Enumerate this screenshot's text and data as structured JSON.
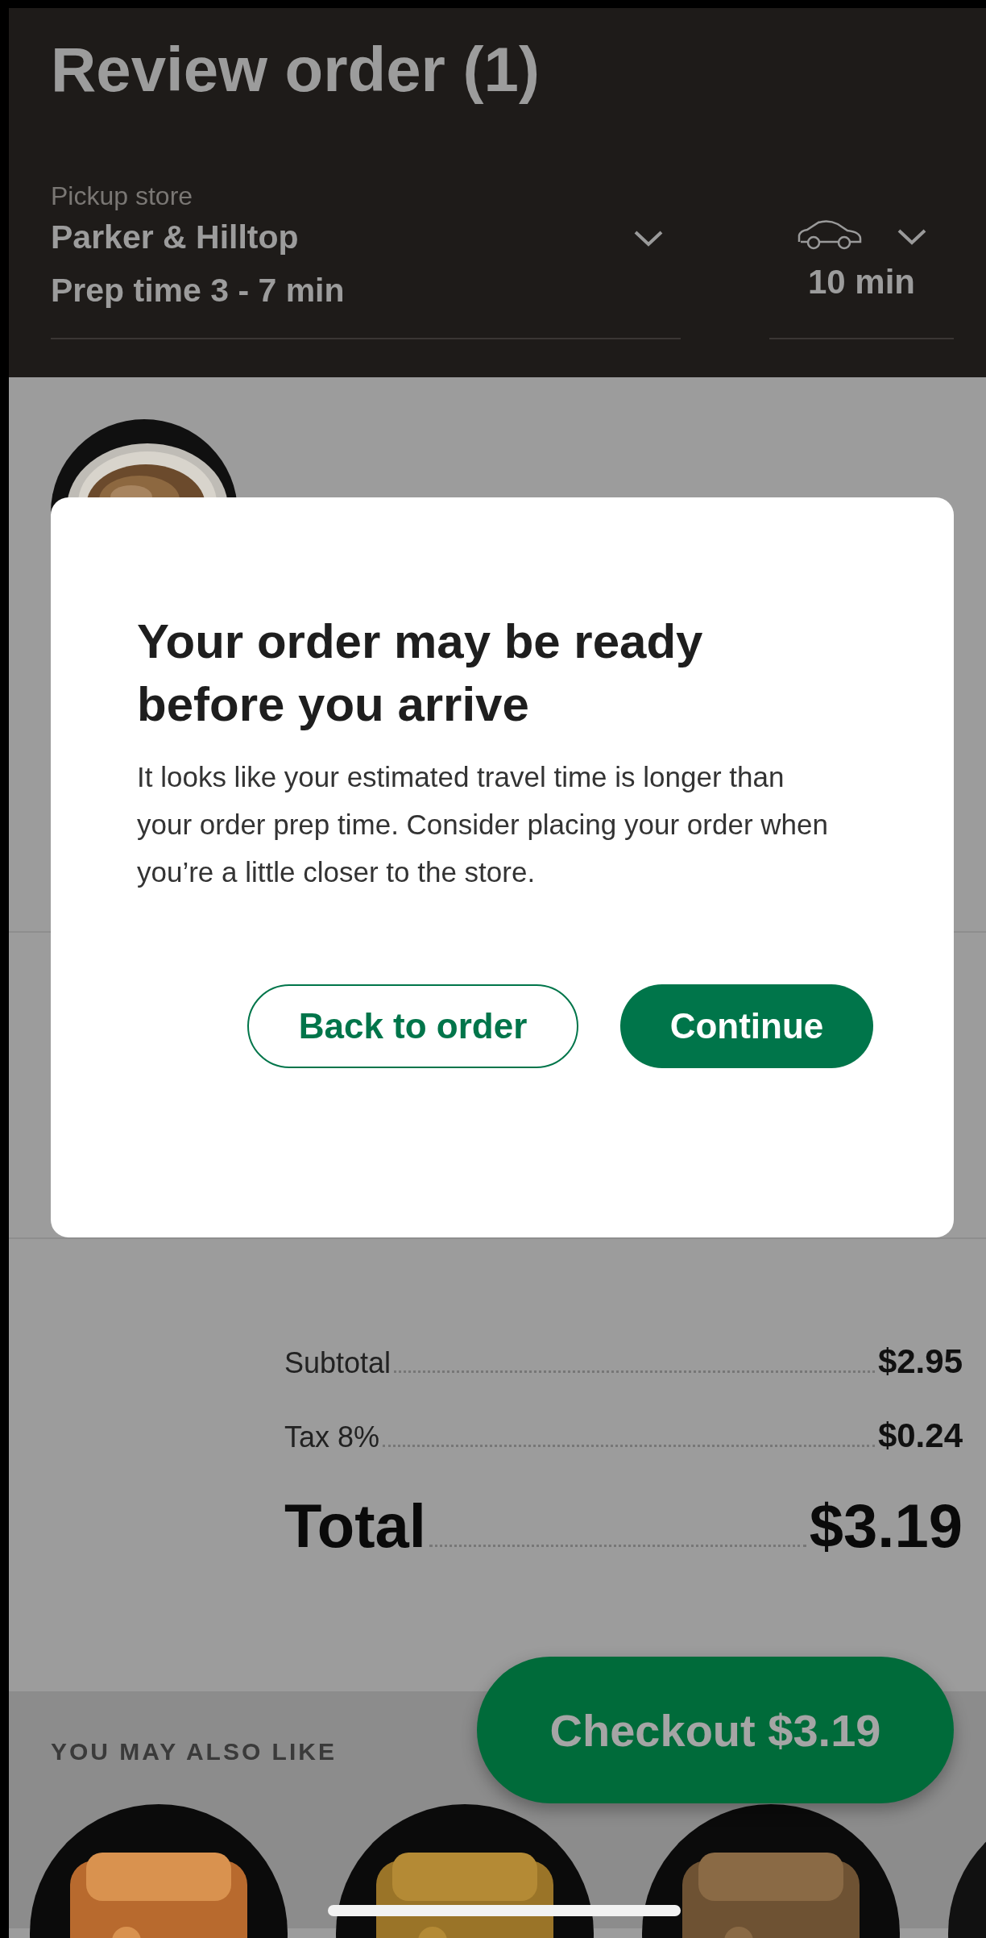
{
  "header": {
    "title": "Review order (1)",
    "store_label": "Pickup store",
    "store_name": "Parker & Hilltop",
    "prep_time": "Prep time 3 - 7 min",
    "travel_time": "10 min"
  },
  "dialog": {
    "title": "Your order may be ready before you arrive",
    "message": "It looks like your estimated travel time is longer than your order prep time. Consider placing your order when you’re a little closer to the store.",
    "buttons": [
      {
        "label": "Back to order",
        "kind": "secondary"
      },
      {
        "label": "Continue",
        "kind": "primary"
      }
    ]
  },
  "summary": [
    {
      "label": "Subtotal",
      "amount": "$2.95",
      "kind": "line"
    },
    {
      "label": "Tax 8%",
      "amount": "$0.24",
      "kind": "line"
    },
    {
      "label": "Total",
      "amount": "$3.19",
      "kind": "total"
    }
  ],
  "checkout_button": "Checkout $3.19",
  "recommendations": {
    "heading": "YOU MAY ALSO LIKE"
  }
}
